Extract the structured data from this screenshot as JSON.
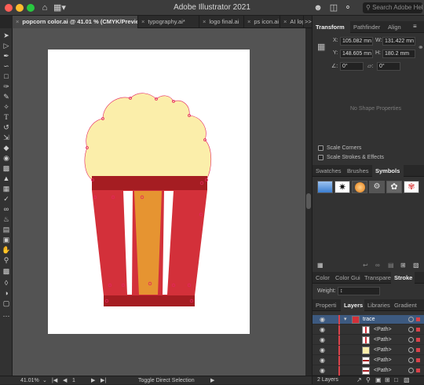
{
  "window": {
    "title": "Adobe Illustrator 2021",
    "search_placeholder": "Search Adobe Help"
  },
  "tabs": [
    {
      "label": "popcorn color.ai @ 41.01 % (CMYK/Preview)",
      "active": true
    },
    {
      "label": "typography.ai*",
      "active": false
    },
    {
      "label": "logo final.ai",
      "active": false
    },
    {
      "label": "ps icon.ai",
      "active": false
    },
    {
      "label": "AI log",
      "active": false
    }
  ],
  "tab_overflow": ">>",
  "tools": [
    "selection-tool",
    "direct-selection-tool",
    "pen-tool",
    "curvature-tool",
    "rectangle-tool",
    "paintbrush-tool",
    "pencil-tool",
    "text-tool",
    "rotate-tool",
    "scale-tool",
    "width-tool",
    "shape-builder-tool",
    "perspective-tool",
    "gradient-tool",
    "eyedropper-tool",
    "blend-tool",
    "symbol-sprayer-tool",
    "graph-tool",
    "artboard-tool",
    "slice-tool",
    "hand-tool",
    "zoom-tool",
    "fill-stroke-swatch",
    "swap-colors",
    "draw-mode",
    "screen-mode",
    "edit-toolbar"
  ],
  "status": {
    "zoom": "41.01%",
    "page": "1",
    "mode": "Toggle Direct Selection"
  },
  "transform_panel": {
    "tabs": [
      "Transform",
      "Pathfinder",
      "Align"
    ],
    "x_label": "X:",
    "x_value": "105.082 mn",
    "w_label": "W:",
    "w_value": "131.422 mn",
    "y_label": "Y:",
    "y_value": "148.605 mn",
    "h_label": "H:",
    "h_value": "180.2 mm",
    "angle_value": "0°",
    "shear_value": "0°",
    "empty_text": "No Shape Properties",
    "scale_corners": "Scale Corners",
    "scale_strokes": "Scale Strokes & Effects"
  },
  "swatch_panel": {
    "tabs": [
      "Swatches",
      "Brushes",
      "Symbols"
    ]
  },
  "color_panel": {
    "tabs": [
      "Color",
      "Color Gui",
      "Transpare",
      "Stroke"
    ],
    "weight_label": "Weight:"
  },
  "layers_panel": {
    "tabs": [
      "Properti",
      "Layers",
      "Libraries",
      "Gradient"
    ],
    "layer_name": "trace",
    "paths": [
      "<Path>",
      "<Path>",
      "<Path>",
      "<Path>",
      "<Path>"
    ],
    "footer": "2 Layers"
  },
  "colors": {
    "popcorn": "#fbeeaa",
    "bucket_red": "#d3303a",
    "band_dark": "#a51d22",
    "stripe_white": "#ffffff",
    "stripe_orange": "#e69431",
    "anchor": "#e5255e",
    "accent_blue": "#3a7ed1"
  }
}
